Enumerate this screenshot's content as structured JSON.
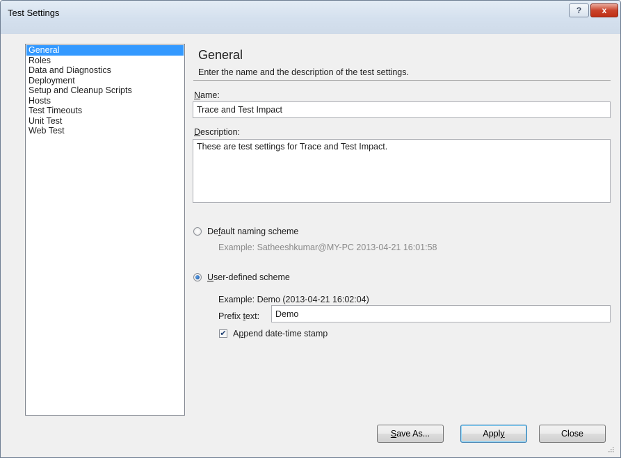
{
  "window": {
    "title": "Test Settings",
    "help_icon": "?",
    "close_icon": "x"
  },
  "nav": {
    "items": [
      {
        "label": "General",
        "selected": true
      },
      {
        "label": "Roles"
      },
      {
        "label": "Data and Diagnostics"
      },
      {
        "label": "Deployment"
      },
      {
        "label": "Setup and Cleanup Scripts"
      },
      {
        "label": "Hosts"
      },
      {
        "label": "Test Timeouts"
      },
      {
        "label": "Unit Test"
      },
      {
        "label": "Web Test"
      }
    ]
  },
  "general": {
    "title": "General",
    "description": "Enter the name and the description of the test settings.",
    "name_label_accel": "N",
    "name_label_rest": "ame:",
    "name_value": "Trace and Test Impact",
    "desc_label_accel": "D",
    "desc_label_rest": "escription:",
    "desc_value": "These are test settings for Trace and Test Impact."
  },
  "naming": {
    "default_label_pre": "De",
    "default_label_accel": "f",
    "default_label_post": "ault naming scheme",
    "default_example": "Example: Satheeshkumar@MY-PC 2013-04-21 16:01:58",
    "user_label_accel": "U",
    "user_label_rest": "ser-defined scheme",
    "user_example": "Example: Demo (2013-04-21 16:02:04)",
    "prefix_label_pre": "Prefix ",
    "prefix_label_accel": "t",
    "prefix_label_post": "ext:",
    "prefix_value": "Demo",
    "append_label_pre": "A",
    "append_label_accel": "p",
    "append_label_post": "pend date-time stamp",
    "append_checked": true,
    "selected_scheme": "user-defined"
  },
  "buttons": {
    "save_as_accel": "S",
    "save_as_rest": "ave As...",
    "apply_pre": "Appl",
    "apply_accel": "y",
    "close": "Close"
  }
}
